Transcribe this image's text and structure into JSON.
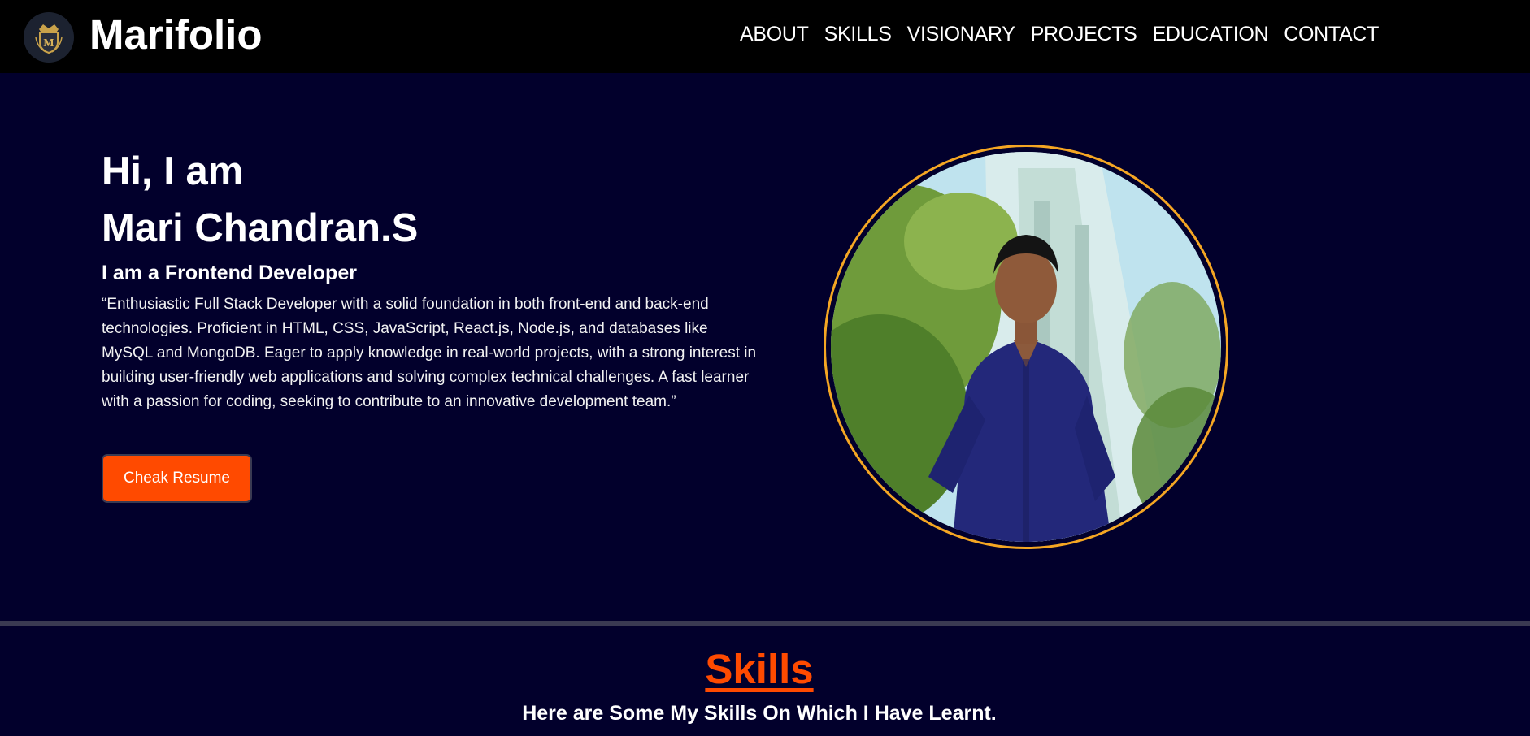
{
  "brand": {
    "logo_icon": "crown-shield-icon",
    "logo_letter": "M",
    "name": "Marifolio"
  },
  "nav": {
    "items": [
      {
        "label": "ABOUT"
      },
      {
        "label": "SKILLS"
      },
      {
        "label": "VISIONARY"
      },
      {
        "label": "PROJECTS"
      },
      {
        "label": "EDUCATION"
      },
      {
        "label": "CONTACT"
      }
    ]
  },
  "hero": {
    "greeting": "Hi, I am",
    "name": "Mari Chandran.S",
    "role": "I am a Frontend Developer",
    "bio": "“Enthusiastic Full Stack Developer with a solid foundation in both front-end and back-end technologies. Proficient in HTML, CSS, JavaScript, React.js, Node.js, and databases like MySQL and MongoDB. Eager to apply knowledge in real-world projects, with a strong interest in building user-friendly web applications and solving complex technical challenges. A fast learner with a passion for coding, seeking to contribute to an innovative development team.”",
    "button_label": "Cheak Resume",
    "photo_icon": "profile-photo"
  },
  "skills": {
    "title": "Skills",
    "subtitle": "Here are Some My Skills On Which I Have Learnt."
  },
  "colors": {
    "background": "#02002c",
    "navbar": "#000000",
    "accent": "#ff4a00",
    "ring": "#f5a623"
  }
}
